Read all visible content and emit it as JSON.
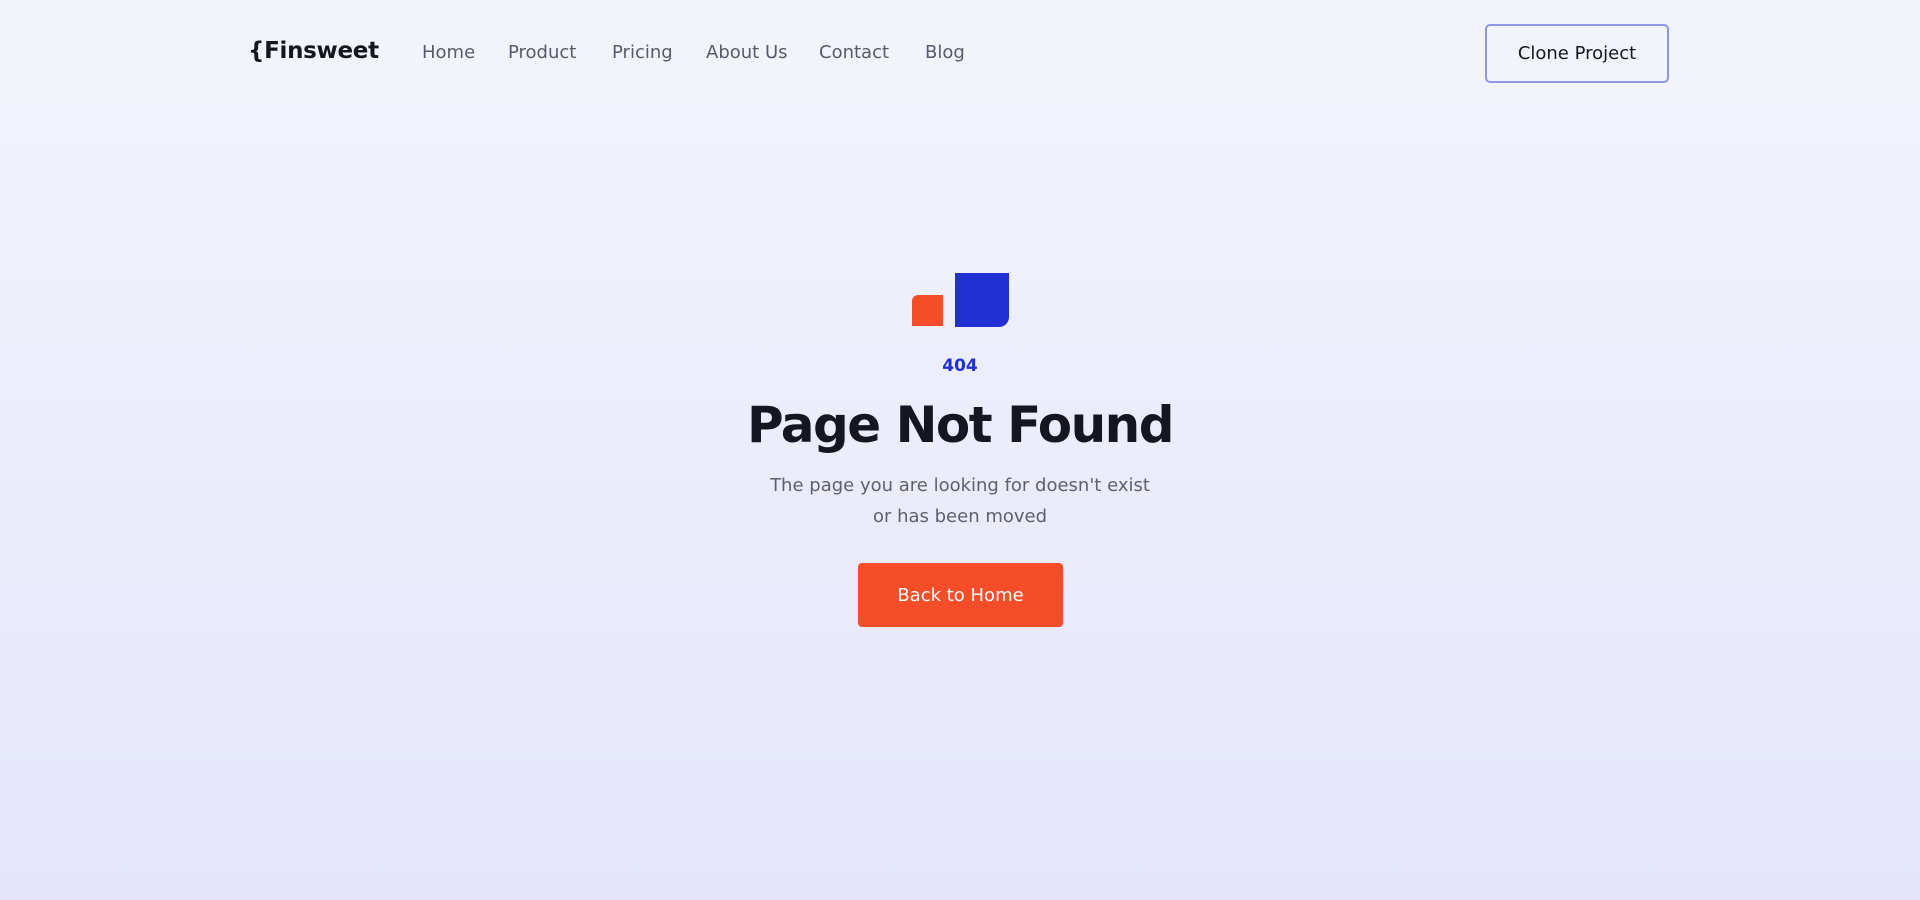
{
  "header": {
    "logo": "{Finsweet",
    "nav": [
      {
        "label": "Home"
      },
      {
        "label": "Product"
      },
      {
        "label": "Pricing"
      },
      {
        "label": "About Us"
      },
      {
        "label": "Contact"
      },
      {
        "label": "Blog"
      }
    ],
    "cta_label": "Clone Project"
  },
  "hero": {
    "illustration": "two-squares-icon",
    "code": "404",
    "title": "Page Not Found",
    "subtitle_lines": [
      "The page you are looking for doesn't exist",
      "or has been moved"
    ],
    "button_label": "Back to Home"
  },
  "colors": {
    "accent_orange": "#f44d27",
    "accent_blue": "#2130d2",
    "text_dark": "#14171f",
    "text_muted": "#5c6170",
    "button_border": "#8e97e4"
  }
}
